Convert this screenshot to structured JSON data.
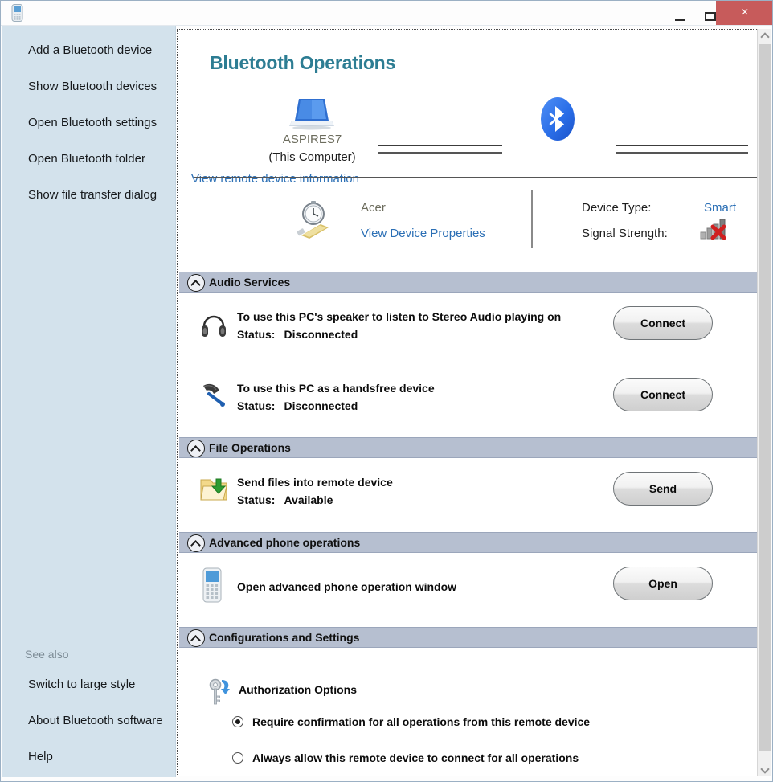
{
  "window": {
    "title": "",
    "icon": "mobile-phone-icon",
    "minimize_label": "Minimize",
    "maximize_label": "Maximize",
    "close_label": "×",
    "close_color": "#c75b5b"
  },
  "sidebar": {
    "items": [
      {
        "label": "Add a Bluetooth device"
      },
      {
        "label": "Show Bluetooth devices"
      },
      {
        "label": "Open Bluetooth settings"
      },
      {
        "label": "Open Bluetooth folder"
      },
      {
        "label": "Show file transfer dialog"
      }
    ],
    "see_also_label": "See also",
    "see_also_items": [
      {
        "label": "Switch to large style"
      },
      {
        "label": "About Bluetooth software"
      },
      {
        "label": "Help"
      }
    ],
    "background": "#d3e2ec"
  },
  "main": {
    "title": "Bluetooth Operations",
    "title_color": "#2d7d93",
    "device_panel": {
      "local": {
        "icon": "laptop-icon",
        "name": "ASPIRES7",
        "subtitle": "(This Computer)",
        "link_label": "View remote device information"
      },
      "bluetooth_icon": "bluetooth-logo-icon",
      "remote": {
        "icon": "usb-stopwatch-device-icon",
        "name": "Acer",
        "link_label": "View Device Properties"
      },
      "properties": [
        {
          "label": "Device Type:",
          "value": "Smart"
        },
        {
          "label": "Signal Strength:",
          "value": "",
          "icon": "signal-bars-disconnected-icon"
        }
      ]
    },
    "sections": [
      {
        "id": "audio-services",
        "title": "Audio Services",
        "expanded": true,
        "rows": [
          {
            "icon": "headphones-icon",
            "title": "To use this PC's speaker to listen to Stereo Audio playing on",
            "status_label": "Status:",
            "status_value": "Disconnected",
            "button": "Connect"
          },
          {
            "icon": "headset-mic-icon",
            "title": "To use this PC as a handsfree device",
            "status_label": "Status:",
            "status_value": "Disconnected",
            "button": "Connect"
          }
        ]
      },
      {
        "id": "file-operations",
        "title": "File Operations",
        "expanded": true,
        "rows": [
          {
            "icon": "folder-send-icon",
            "title": "Send files into remote device",
            "status_label": "Status:",
            "status_value": "Available",
            "button": "Send"
          }
        ]
      },
      {
        "id": "advanced-phone-operations",
        "title": "Advanced phone operations",
        "expanded": true,
        "rows": [
          {
            "icon": "mobile-phone-icon",
            "title": "Open advanced phone operation window",
            "status_label": "",
            "status_value": "",
            "button": "Open"
          }
        ]
      },
      {
        "id": "configurations-and-settings",
        "title": "Configurations and Settings",
        "expanded": true,
        "authorization": {
          "icon": "key-icon",
          "title": "Authorization Options",
          "options": [
            {
              "label": "Require confirmation for all operations from this remote device",
              "selected": true
            },
            {
              "label": "Always allow this remote device to connect for all operations",
              "selected": false
            }
          ]
        }
      }
    ]
  },
  "scrollbar": {
    "up_label": "scroll-up",
    "down_label": "scroll-down"
  }
}
